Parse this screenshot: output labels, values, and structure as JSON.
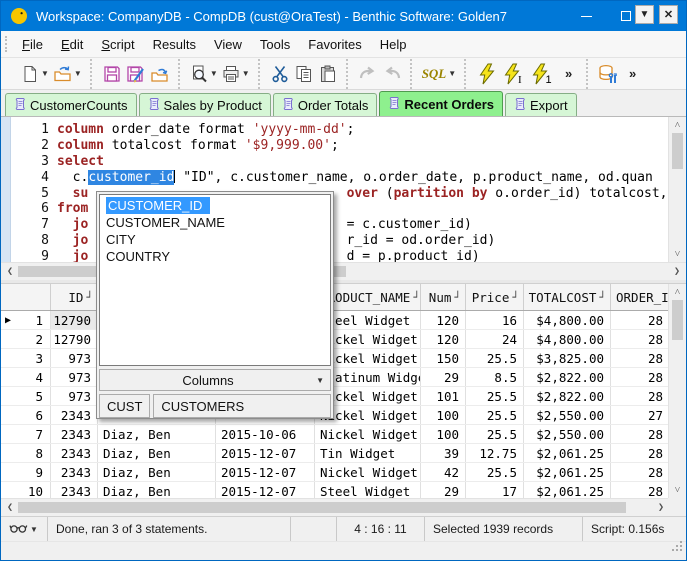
{
  "window": {
    "title": "Workspace: CompanyDB - CompDB (cust@OraTest) - Benthic Software: Golden7",
    "controls": {
      "minimize": "minimize",
      "maximize": "maximize",
      "close": "✕"
    }
  },
  "menu": {
    "items": [
      {
        "label": "File",
        "mnemonic": true
      },
      {
        "label": "Edit",
        "mnemonic": true
      },
      {
        "label": "Script",
        "mnemonic": true
      },
      {
        "label": "Results",
        "mnemonic": false
      },
      {
        "label": "View",
        "mnemonic": false
      },
      {
        "label": "Tools",
        "mnemonic": false
      },
      {
        "label": "Favorites",
        "mnemonic": false
      },
      {
        "label": "Help",
        "mnemonic": false
      }
    ]
  },
  "toolbar": {
    "groups": [
      {
        "buttons": [
          {
            "name": "new-file",
            "icon": "new-file-icon",
            "dropdown": true
          },
          {
            "name": "open-file",
            "icon": "open-folder-icon",
            "dropdown": true
          }
        ]
      },
      {
        "buttons": [
          {
            "name": "save",
            "icon": "save-icon"
          },
          {
            "name": "save-as",
            "icon": "save-as-icon"
          },
          {
            "name": "revert",
            "icon": "revert-icon"
          }
        ]
      },
      {
        "buttons": [
          {
            "name": "print-preview",
            "icon": "print-preview-icon",
            "dropdown": true
          },
          {
            "name": "print",
            "icon": "print-icon",
            "dropdown": true
          }
        ]
      },
      {
        "buttons": [
          {
            "name": "cut",
            "icon": "cut-icon"
          },
          {
            "name": "copy",
            "icon": "copy-icon"
          },
          {
            "name": "paste",
            "icon": "paste-icon"
          }
        ]
      },
      {
        "buttons": [
          {
            "name": "redo",
            "icon": "redo-icon"
          },
          {
            "name": "undo",
            "icon": "undo-icon"
          }
        ]
      },
      {
        "buttons": [
          {
            "name": "sql-options",
            "icon": "sql-icon",
            "sql_label": "SQL",
            "dropdown": true
          }
        ]
      },
      {
        "buttons": [
          {
            "name": "run-script",
            "icon": "run-script-icon"
          },
          {
            "name": "run-statement",
            "icon": "run-statement-icon"
          },
          {
            "name": "run-one",
            "icon": "run-one-icon"
          },
          {
            "name": "toolbar-overflow",
            "label": "»"
          }
        ]
      },
      {
        "buttons": [
          {
            "name": "db-tools",
            "icon": "db-tools-icon"
          },
          {
            "name": "toolbar-overflow-2",
            "label": "»"
          }
        ]
      }
    ]
  },
  "tabs": {
    "items": [
      {
        "label": "CustomerCounts",
        "active": false
      },
      {
        "label": "Sales by Product",
        "active": false
      },
      {
        "label": "Order Totals",
        "active": false
      },
      {
        "label": "Recent Orders",
        "active": true
      },
      {
        "label": "Export",
        "active": false
      }
    ],
    "dropdown_button": "▼",
    "close_button": "✕"
  },
  "editor": {
    "lines": [
      {
        "n": "1",
        "segs": [
          [
            "k",
            "column"
          ],
          [
            "p",
            " order_date format "
          ],
          [
            "s",
            "'yyyy-mm-dd'"
          ],
          [
            "p",
            ";"
          ]
        ]
      },
      {
        "n": "2",
        "segs": [
          [
            "k",
            "column"
          ],
          [
            "p",
            " totalcost format "
          ],
          [
            "s",
            "'$9,999.00'"
          ],
          [
            "p",
            ";"
          ]
        ]
      },
      {
        "n": "3",
        "segs": [
          [
            "k",
            "select"
          ]
        ]
      },
      {
        "n": "4",
        "segs": [
          [
            "p",
            "  c."
          ],
          [
            "sel",
            "customer_id"
          ],
          [
            "caret",
            ""
          ],
          [
            "p",
            " \"ID\", c.customer_name, o.order_date, p.product_name, od.quan"
          ]
        ]
      },
      {
        "n": "5",
        "segs": [
          [
            "p",
            "  "
          ],
          [
            "k",
            "su"
          ],
          [
            "p",
            "                                 "
          ],
          [
            "k",
            "over"
          ],
          [
            "p",
            " ("
          ],
          [
            "k",
            "partition by"
          ],
          [
            "p",
            " o.order_id) totalcost,"
          ]
        ]
      },
      {
        "n": "6",
        "segs": [
          [
            "k",
            "from"
          ]
        ]
      },
      {
        "n": "7",
        "segs": [
          [
            "p",
            "  "
          ],
          [
            "k",
            "jo"
          ],
          [
            "p",
            "                                 "
          ],
          [
            "p",
            "= c.customer_id)"
          ]
        ]
      },
      {
        "n": "8",
        "segs": [
          [
            "p",
            "  "
          ],
          [
            "k",
            "jo"
          ],
          [
            "p",
            "                                 "
          ],
          [
            "p",
            "r_id = od.order_id)"
          ]
        ]
      },
      {
        "n": "9",
        "segs": [
          [
            "p",
            "  "
          ],
          [
            "k",
            "jo"
          ],
          [
            "p",
            "                                 "
          ],
          [
            "p",
            "d = p.product_id)"
          ]
        ]
      }
    ]
  },
  "autocomplete": {
    "items": [
      {
        "label": "CUSTOMER_ID",
        "selected": true
      },
      {
        "label": "CUSTOMER_NAME",
        "selected": false
      },
      {
        "label": "CITY",
        "selected": false
      },
      {
        "label": "COUNTRY",
        "selected": false
      }
    ],
    "columns_label": "Columns",
    "tabs": [
      "CUST",
      "CUSTOMERS"
    ]
  },
  "grid": {
    "header": [
      "",
      "ID",
      "",
      "",
      "PRODUCT_NAME",
      "Num",
      "Price",
      "TOTALCOST",
      "ORDER_I"
    ],
    "sort_icon": "┘",
    "rows": [
      {
        "marker": "▶",
        "cells": [
          "1",
          "12790",
          "",
          "",
          "Steel Widget",
          "120",
          "16",
          "$4,800.00",
          "28"
        ]
      },
      {
        "marker": "",
        "cells": [
          "2",
          "12790",
          "",
          "",
          "Nickel Widget",
          "120",
          "24",
          "$4,800.00",
          "28"
        ]
      },
      {
        "marker": "",
        "cells": [
          "3",
          "973",
          "",
          "",
          "Nickel Widget",
          "150",
          "25.5",
          "$3,825.00",
          "28"
        ]
      },
      {
        "marker": "",
        "cells": [
          "4",
          "973",
          "",
          "",
          "Platinum Widget",
          "29",
          "8.5",
          "$2,822.00",
          "28"
        ]
      },
      {
        "marker": "",
        "cells": [
          "5",
          "973",
          "",
          "",
          "Nickel Widget",
          "101",
          "25.5",
          "$2,822.00",
          "28"
        ]
      },
      {
        "marker": "",
        "cells": [
          "6",
          "2343",
          "",
          "",
          "Nickel Widget",
          "100",
          "25.5",
          "$2,550.00",
          "27"
        ]
      },
      {
        "marker": "",
        "cells": [
          "7",
          "2343",
          "Diaz, Ben",
          "2015-10-06",
          "Nickel Widget",
          "100",
          "25.5",
          "$2,550.00",
          "28"
        ]
      },
      {
        "marker": "",
        "cells": [
          "8",
          "2343",
          "Diaz, Ben",
          "2015-12-07",
          "Tin Widget",
          "39",
          "12.75",
          "$2,061.25",
          "28"
        ]
      },
      {
        "marker": "",
        "cells": [
          "9",
          "2343",
          "Diaz, Ben",
          "2015-12-07",
          "Nickel Widget",
          "42",
          "25.5",
          "$2,061.25",
          "28"
        ]
      },
      {
        "marker": "",
        "cells": [
          "10",
          "2343",
          "Diaz, Ben",
          "2015-12-07",
          "Steel Widget",
          "29",
          "17",
          "$2,061.25",
          "28"
        ]
      }
    ]
  },
  "status": {
    "message": "Done, ran 3 of 3 statements.",
    "position": "4 : 16 : 11",
    "selected": "Selected 1939 records",
    "script_time": "Script: 0.156s"
  },
  "colors": {
    "titlebar": "#0078D7",
    "tab_active": "#8ef08e",
    "tab_inactive": "#d6f6d6",
    "keyword": "#9b2323",
    "selection": "#2f86e2",
    "run_bolt": "#f6e41b"
  }
}
